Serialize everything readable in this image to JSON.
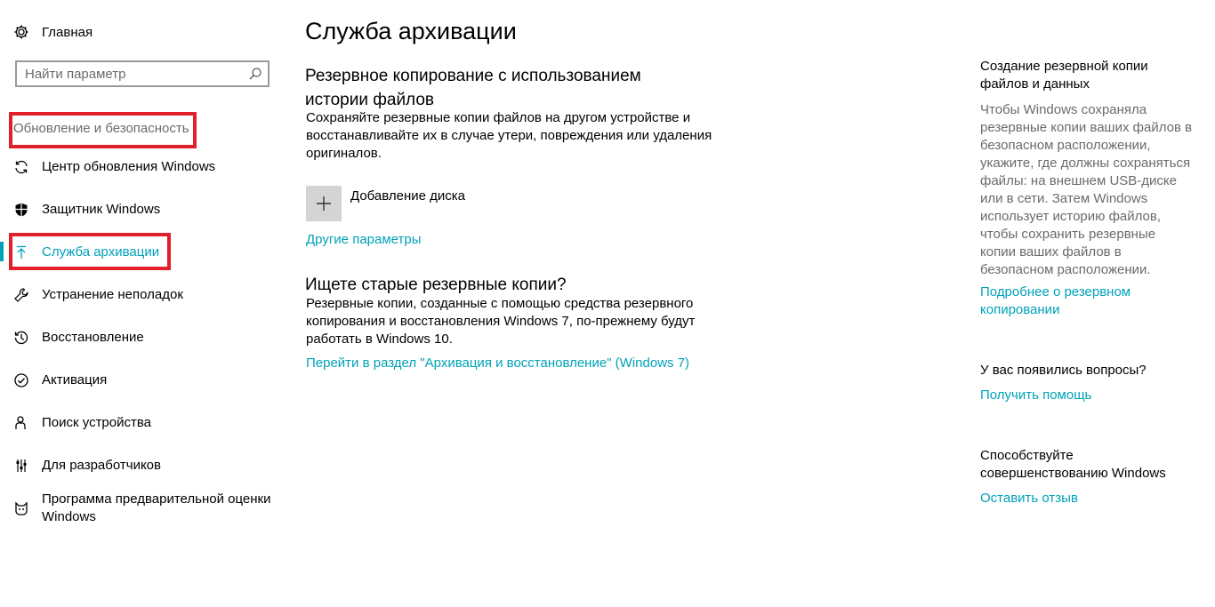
{
  "sidebar": {
    "home_label": "Главная",
    "search_placeholder": "Найти параметр",
    "section_label": "Обновление и безопасность",
    "items": [
      {
        "label": "Центр обновления Windows",
        "icon": "refresh-icon"
      },
      {
        "label": "Защитник Windows",
        "icon": "shield-icon"
      },
      {
        "label": "Служба архивации",
        "icon": "backup-arrow-icon",
        "active": true
      },
      {
        "label": "Устранение неполадок",
        "icon": "wrench-icon"
      },
      {
        "label": "Восстановление",
        "icon": "history-icon"
      },
      {
        "label": "Активация",
        "icon": "check-circle-icon"
      },
      {
        "label": "Поиск устройства",
        "icon": "person-location-icon"
      },
      {
        "label": "Для разработчиков",
        "icon": "developer-sliders-icon"
      },
      {
        "label": "Программа предварительной оценки Windows",
        "icon": "insider-cat-icon"
      }
    ]
  },
  "main": {
    "title": "Служба архивации",
    "section1": {
      "title": "Резервное копирование с использованием истории файлов",
      "description": "Сохраняйте резервные копии файлов на другом устройстве и восстанавливайте их в случае утери, повреждения или удаления оригиналов.",
      "add_disk_label": "Добавление диска",
      "other_params_link": "Другие параметры"
    },
    "section2": {
      "title": "Ищете старые резервные копии?",
      "description": "Резервные копии, созданные с помощью средства резервного копирования и восстановления Windows 7, по-прежнему будут работать в Windows 10.",
      "link": "Перейти в раздел \"Архивация и восстановление\" (Windows 7)"
    }
  },
  "right_panel": {
    "block1": {
      "title": "Создание резервной копии файлов и данных",
      "text": "Чтобы Windows сохраняла резервные копии ваших файлов в безопасном расположении, укажите, где должны сохраняться файлы: на внешнем USB-диске или в сети. Затем Windows использует историю файлов, чтобы сохранить резервные копии ваших файлов в безопасном расположении.",
      "link": "Подробнее о резервном копировании"
    },
    "block2": {
      "title": "У вас появились вопросы?",
      "link": "Получить помощь"
    },
    "block3": {
      "title": "Способствуйте совершенствованию Windows",
      "link": "Оставить отзыв"
    }
  },
  "colors": {
    "accent": "#00a2b8",
    "highlight_box": "#e0202a",
    "secondary_text": "#6b6b6b",
    "add_button_bg": "#d4d4d4"
  }
}
